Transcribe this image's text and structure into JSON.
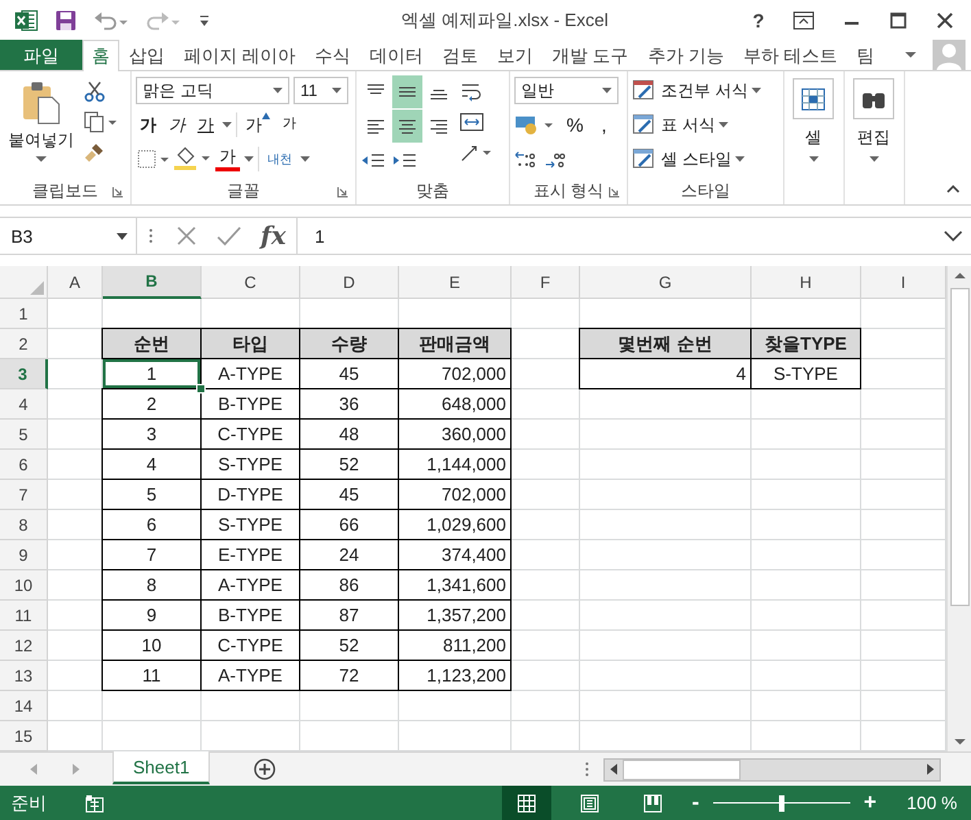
{
  "title_bar": {
    "title": "엑셀 예제파일.xlsx - Excel",
    "help": "?"
  },
  "tabs": [
    {
      "label": "파일",
      "kind": "file",
      "selected": false
    },
    {
      "label": "홈",
      "kind": "tab",
      "selected": true
    },
    {
      "label": "삽입",
      "kind": "tab",
      "selected": false
    },
    {
      "label": "페이지 레이아",
      "kind": "tab",
      "selected": false
    },
    {
      "label": "수식",
      "kind": "tab",
      "selected": false
    },
    {
      "label": "데이터",
      "kind": "tab",
      "selected": false
    },
    {
      "label": "검토",
      "kind": "tab",
      "selected": false
    },
    {
      "label": "보기",
      "kind": "tab",
      "selected": false
    },
    {
      "label": "개발 도구",
      "kind": "tab",
      "selected": false
    },
    {
      "label": "추가 기능",
      "kind": "tab",
      "selected": false
    },
    {
      "label": "부하 테스트",
      "kind": "tab",
      "selected": false
    },
    {
      "label": "팀",
      "kind": "tab",
      "selected": false
    }
  ],
  "ribbon": {
    "groups": [
      {
        "kind": "clipboard",
        "label": "클립보드",
        "paste": "붙여넣기"
      },
      {
        "kind": "font",
        "label": "글꼴",
        "font": "맑은 고딕",
        "size": "11",
        "styles": [
          {
            "label": "가",
            "kind": "bold"
          },
          {
            "label": "가",
            "kind": "italic"
          },
          {
            "label": "가",
            "kind": "underline"
          }
        ],
        "grow": "가",
        "shrink": "가",
        "font_color": "가",
        "phonetic": "내천"
      },
      {
        "kind": "alignment",
        "label": "맞춤",
        "buttons": [
          {
            "kind": "top",
            "selected": false
          },
          {
            "kind": "middle",
            "selected": true
          },
          {
            "kind": "bottom",
            "selected": false
          },
          {
            "kind": "left",
            "selected": false
          },
          {
            "kind": "center",
            "selected": true
          },
          {
            "kind": "right",
            "selected": false
          }
        ]
      },
      {
        "kind": "number",
        "label": "표시 형식",
        "format": "일반",
        "percent": "%",
        "comma": ","
      },
      {
        "kind": "styles",
        "label": "스타일",
        "items": [
          "조건부 서식",
          "표 서식",
          "셀 스타일"
        ]
      },
      {
        "kind": "cells",
        "button": "셀"
      },
      {
        "kind": "editing",
        "button": "편집"
      }
    ]
  },
  "formula_bar": {
    "name_box": "B3",
    "fx": "fx",
    "value": "1"
  },
  "grid": {
    "columns": [
      {
        "label": "A",
        "selected": false
      },
      {
        "label": "B",
        "selected": true
      },
      {
        "label": "C",
        "selected": false
      },
      {
        "label": "D",
        "selected": false
      },
      {
        "label": "E",
        "selected": false
      },
      {
        "label": "F",
        "selected": false
      },
      {
        "label": "G",
        "selected": false
      },
      {
        "label": "H",
        "selected": false
      },
      {
        "label": "I",
        "selected": false
      }
    ],
    "rows": [
      {
        "number": "1",
        "selected": false
      },
      {
        "number": "2",
        "selected": false,
        "cells": [
          null,
          {
            "text": "순번",
            "kind": "header",
            "selected": false
          },
          {
            "text": "타입",
            "kind": "header",
            "selected": false
          },
          {
            "text": "수량",
            "kind": "header",
            "selected": false
          },
          {
            "text": "판매금액",
            "kind": "header",
            "selected": false
          },
          null,
          {
            "text": "몇번째 순번",
            "kind": "header",
            "selected": false
          },
          {
            "text": "찾을TYPE",
            "kind": "header",
            "selected": false
          }
        ]
      },
      {
        "number": "3",
        "selected": true,
        "cells": [
          null,
          {
            "text": "1",
            "kind": "center",
            "selected": true
          },
          {
            "text": "A-TYPE",
            "kind": "center",
            "selected": false
          },
          {
            "text": "45",
            "kind": "center",
            "selected": false
          },
          {
            "text": "702,000",
            "kind": "right",
            "selected": false
          },
          null,
          {
            "text": "4",
            "kind": "right",
            "selected": false
          },
          {
            "text": "S-TYPE",
            "kind": "center",
            "selected": false
          }
        ]
      },
      {
        "number": "4",
        "selected": false,
        "cells": [
          null,
          {
            "text": "2",
            "kind": "center",
            "selected": false
          },
          {
            "text": "B-TYPE",
            "kind": "center",
            "selected": false
          },
          {
            "text": "36",
            "kind": "center",
            "selected": false
          },
          {
            "text": "648,000",
            "kind": "right",
            "selected": false
          }
        ]
      },
      {
        "number": "5",
        "selected": false,
        "cells": [
          null,
          {
            "text": "3",
            "kind": "center",
            "selected": false
          },
          {
            "text": "C-TYPE",
            "kind": "center",
            "selected": false
          },
          {
            "text": "48",
            "kind": "center",
            "selected": false
          },
          {
            "text": "360,000",
            "kind": "right",
            "selected": false
          }
        ]
      },
      {
        "number": "6",
        "selected": false,
        "cells": [
          null,
          {
            "text": "4",
            "kind": "center",
            "selected": false
          },
          {
            "text": "S-TYPE",
            "kind": "center",
            "selected": false
          },
          {
            "text": "52",
            "kind": "center",
            "selected": false
          },
          {
            "text": "1,144,000",
            "kind": "right",
            "selected": false
          }
        ]
      },
      {
        "number": "7",
        "selected": false,
        "cells": [
          null,
          {
            "text": "5",
            "kind": "center",
            "selected": false
          },
          {
            "text": "D-TYPE",
            "kind": "center",
            "selected": false
          },
          {
            "text": "45",
            "kind": "center",
            "selected": false
          },
          {
            "text": "702,000",
            "kind": "right",
            "selected": false
          }
        ]
      },
      {
        "number": "8",
        "selected": false,
        "cells": [
          null,
          {
            "text": "6",
            "kind": "center",
            "selected": false
          },
          {
            "text": "S-TYPE",
            "kind": "center",
            "selected": false
          },
          {
            "text": "66",
            "kind": "center",
            "selected": false
          },
          {
            "text": "1,029,600",
            "kind": "right",
            "selected": false
          }
        ]
      },
      {
        "number": "9",
        "selected": false,
        "cells": [
          null,
          {
            "text": "7",
            "kind": "center",
            "selected": false
          },
          {
            "text": "E-TYPE",
            "kind": "center",
            "selected": false
          },
          {
            "text": "24",
            "kind": "center",
            "selected": false
          },
          {
            "text": "374,400",
            "kind": "right",
            "selected": false
          }
        ]
      },
      {
        "number": "10",
        "selected": false,
        "cells": [
          null,
          {
            "text": "8",
            "kind": "center",
            "selected": false
          },
          {
            "text": "A-TYPE",
            "kind": "center",
            "selected": false
          },
          {
            "text": "86",
            "kind": "center",
            "selected": false
          },
          {
            "text": "1,341,600",
            "kind": "right",
            "selected": false
          }
        ]
      },
      {
        "number": "11",
        "selected": false,
        "cells": [
          null,
          {
            "text": "9",
            "kind": "center",
            "selected": false
          },
          {
            "text": "B-TYPE",
            "kind": "center",
            "selected": false
          },
          {
            "text": "87",
            "kind": "center",
            "selected": false
          },
          {
            "text": "1,357,200",
            "kind": "right",
            "selected": false
          }
        ]
      },
      {
        "number": "12",
        "selected": false,
        "cells": [
          null,
          {
            "text": "10",
            "kind": "center",
            "selected": false
          },
          {
            "text": "C-TYPE",
            "kind": "center",
            "selected": false
          },
          {
            "text": "52",
            "kind": "center",
            "selected": false
          },
          {
            "text": "811,200",
            "kind": "right",
            "selected": false
          }
        ]
      },
      {
        "number": "13",
        "selected": false,
        "cells": [
          null,
          {
            "text": "11",
            "kind": "center",
            "selected": false
          },
          {
            "text": "A-TYPE",
            "kind": "center",
            "selected": false
          },
          {
            "text": "72",
            "kind": "center",
            "selected": false
          },
          {
            "text": "1,123,200",
            "kind": "right",
            "selected": false
          }
        ]
      },
      {
        "number": "14",
        "selected": false
      },
      {
        "number": "15",
        "selected": false
      }
    ]
  },
  "sheet_tabs": [
    {
      "label": "Sheet1",
      "selected": true
    }
  ],
  "status_bar": {
    "status": "준비",
    "views": [
      {
        "kind": "normal",
        "selected": true
      },
      {
        "kind": "page_layout",
        "selected": false
      },
      {
        "kind": "page_break",
        "selected": false
      }
    ],
    "zoom_out": "-",
    "zoom_in": "+",
    "zoom": {
      "level": 0.5
    },
    "zoom_text": "100 %"
  }
}
